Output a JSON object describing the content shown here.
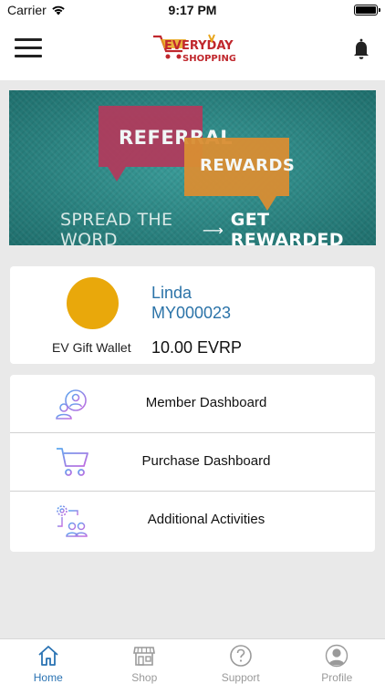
{
  "status_bar": {
    "carrier": "Carrier",
    "time": "9:17 PM"
  },
  "header": {
    "logo_line1": "EVERYDAY",
    "logo_line2": "SHOPPING"
  },
  "banner": {
    "bubble1": "REFERRAL",
    "bubble2": "REWARDS",
    "tagline_left": "SPREAD THE WORD",
    "tagline_right": "GET REWARDED"
  },
  "profile": {
    "name": "Linda",
    "member_id": "MY000023",
    "wallet_label": "EV Gift Wallet",
    "wallet_value": "10.00 EVRP"
  },
  "menu": {
    "items": [
      {
        "label": "Member Dashboard",
        "icon": "members-icon"
      },
      {
        "label": "Purchase Dashboard",
        "icon": "cart-icon"
      },
      {
        "label": "Additional Activities",
        "icon": "activities-icon"
      }
    ]
  },
  "tabs": [
    {
      "label": "Home",
      "icon": "home-icon",
      "active": true
    },
    {
      "label": "Shop",
      "icon": "shop-icon",
      "active": false
    },
    {
      "label": "Support",
      "icon": "support-icon",
      "active": false
    },
    {
      "label": "Profile",
      "icon": "profile-icon",
      "active": false
    }
  ],
  "colors": {
    "accent": "#2a73b3",
    "name_blue": "#2b73a8",
    "wallet_circle": "#e9a80b",
    "banner_teal": "#2f8c8a",
    "referral_bubble": "#b23a5c",
    "rewards_bubble": "#d98e33"
  }
}
